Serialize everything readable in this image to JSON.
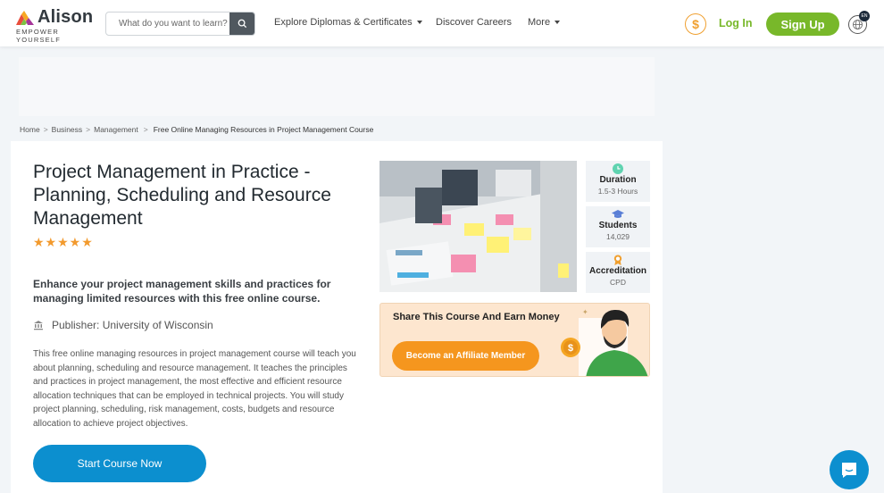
{
  "header": {
    "logo_text": "Alison",
    "logo_tagline": "EMPOWER YOURSELF",
    "search_placeholder": "What do you want to learn?",
    "nav": [
      {
        "label": "Explore Diplomas & Certificates",
        "has_dropdown": true
      },
      {
        "label": "Discover Careers",
        "has_dropdown": false
      },
      {
        "label": "More",
        "has_dropdown": true
      }
    ],
    "coin_symbol": "$",
    "login_label": "Log In",
    "signup_label": "Sign Up",
    "language_badge": "EN"
  },
  "breadcrumb": {
    "items": [
      "Home",
      "Business",
      "Management"
    ],
    "current": "Free Online Managing Resources in Project Management Course"
  },
  "course": {
    "title": "Project Management in Practice - Planning, Scheduling and Resource Management",
    "rating_stars": "★★★★★",
    "rating": 5,
    "subtitle": "Enhance your project management skills and practices for managing limited resources with this free online course.",
    "publisher": "Publisher: University of Wisconsin",
    "description": "This free online managing resources in project management course will teach you about planning, scheduling and resource management. It teaches the principles and practices in project management, the most effective and efficient resource allocation techniques that can be employed in technical projects. You will study project planning, scheduling, risk management, costs, budgets and resource allocation to achieve project objectives.",
    "start_label": "Start Course Now",
    "stats": [
      {
        "icon": "clock-icon",
        "label": "Duration",
        "value": "1.5-3 Hours"
      },
      {
        "icon": "graduation-cap-icon",
        "label": "Students",
        "value": "14,029"
      },
      {
        "icon": "award-icon",
        "label": "Accreditation",
        "value": "CPD"
      }
    ]
  },
  "affiliate": {
    "title": "Share This Course And Earn Money",
    "button_label": "Become an Affiliate Member",
    "coin_symbol": "$"
  },
  "colors": {
    "brand_green": "#78b82a",
    "primary_blue": "#0c8fcf",
    "affiliate_orange": "#f5961e",
    "star_orange": "#f29a2e"
  }
}
